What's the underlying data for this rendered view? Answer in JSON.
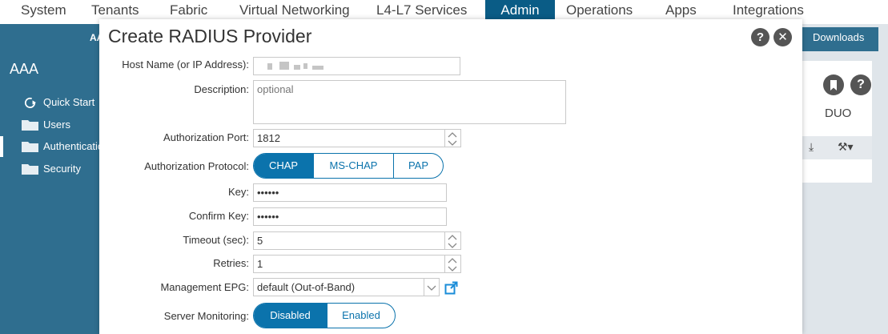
{
  "topnav": {
    "tabs": [
      {
        "label": "System"
      },
      {
        "label": "Tenants"
      },
      {
        "label": "Fabric"
      },
      {
        "label": "Virtual Networking"
      },
      {
        "label": "L4-L7 Services"
      },
      {
        "label": "Admin",
        "active": true
      },
      {
        "label": "Operations"
      },
      {
        "label": "Apps"
      },
      {
        "label": "Integrations"
      }
    ]
  },
  "sidebar": {
    "subtitle": "AA",
    "title": "AAA",
    "items": [
      {
        "label": "Quick Start",
        "icon": "quick-start-icon"
      },
      {
        "label": "Users",
        "icon": "folder-icon"
      },
      {
        "label": "Authenticatic",
        "icon": "folder-icon",
        "active": true
      },
      {
        "label": "Security",
        "icon": "folder-icon"
      }
    ]
  },
  "right_panel": {
    "downloads_label": "Downloads",
    "duo_label": "DUO",
    "bookmark_icon": "bookmark-icon",
    "help_icon_text": "?",
    "download_icon_glyph": "⤓",
    "tools_icon_glyph": "⚒▾"
  },
  "dialog": {
    "title": "Create RADIUS Provider",
    "help_text": "?",
    "close_text": "✕",
    "fields": {
      "host": {
        "label": "Host Name (or IP Address):",
        "value": ""
      },
      "description": {
        "label": "Description:",
        "placeholder": "optional"
      },
      "auth_port": {
        "label": "Authorization Port:",
        "value": "1812"
      },
      "auth_protocol": {
        "label": "Authorization Protocol:",
        "options": [
          "CHAP",
          "MS-CHAP",
          "PAP"
        ],
        "selected": "CHAP"
      },
      "key": {
        "label": "Key:",
        "value": "••••••"
      },
      "confirm_key": {
        "label": "Confirm Key:",
        "value": "••••••"
      },
      "timeout": {
        "label": "Timeout (sec):",
        "value": "5"
      },
      "retries": {
        "label": "Retries:",
        "value": "1"
      },
      "mgmt_epg": {
        "label": "Management EPG:",
        "value": "default (Out-of-Band)"
      },
      "server_monitoring": {
        "label": "Server Monitoring:",
        "options": [
          "Disabled",
          "Enabled"
        ],
        "selected": "Disabled"
      }
    }
  },
  "colors": {
    "accent": "#0b73ac",
    "sidebar": "#2f6e8f",
    "nav_active": "#0a5c86"
  }
}
